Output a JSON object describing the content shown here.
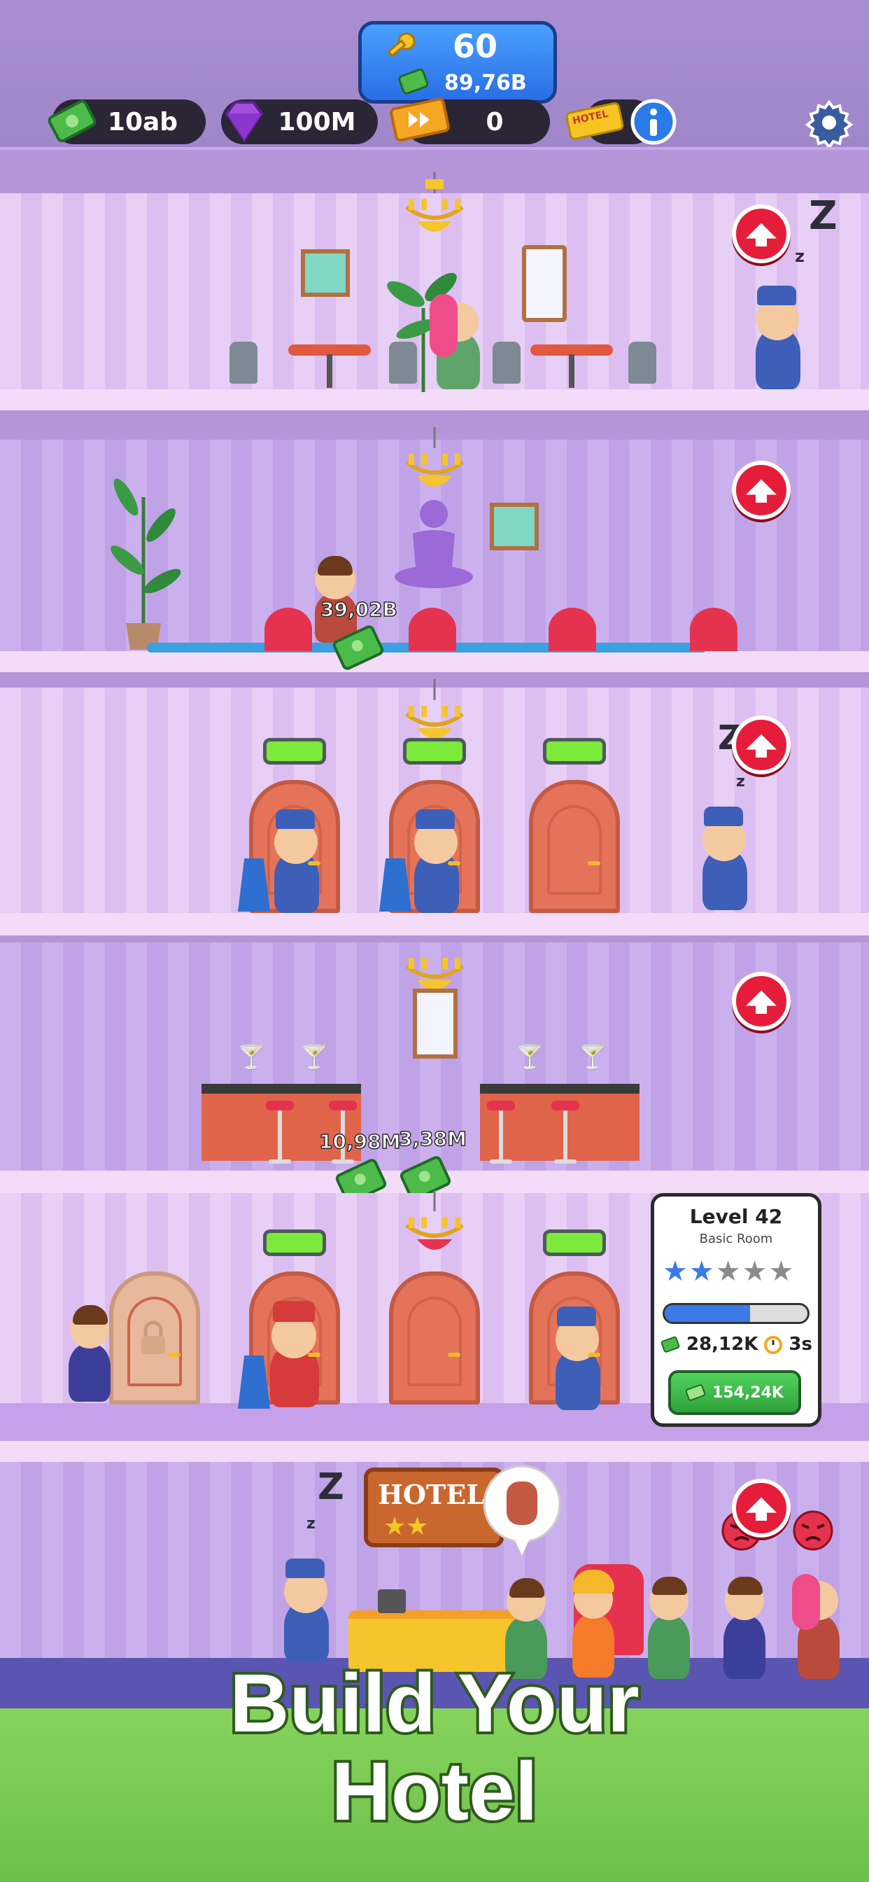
{
  "hud": {
    "keys": "60",
    "key_cash": "89,76B",
    "cash": "10ab",
    "gems": "100M",
    "boost": "0",
    "hotel_ticket_label": "HOTEL",
    "colors": {
      "panel": "#2a2636",
      "key_box": "#2a6ee6",
      "gem": "#a24fe0",
      "cash": "#4cbb4a"
    }
  },
  "floors": {
    "gym_earning": "39,02B",
    "bar_earnings": [
      "10,98M",
      "3,38M"
    ]
  },
  "level_card": {
    "title": "Level 42",
    "subtitle": "Basic Room",
    "stars_filled": 2,
    "stars_total": 5,
    "xp_progress": 0.6,
    "income": "28,12K",
    "time": "3s",
    "upgrade_price": "154,24K"
  },
  "lobby": {
    "sign_text": "HOTEL",
    "sign_stars": "★★"
  },
  "banner": {
    "line1": "Build Your",
    "line2": "Hotel"
  }
}
